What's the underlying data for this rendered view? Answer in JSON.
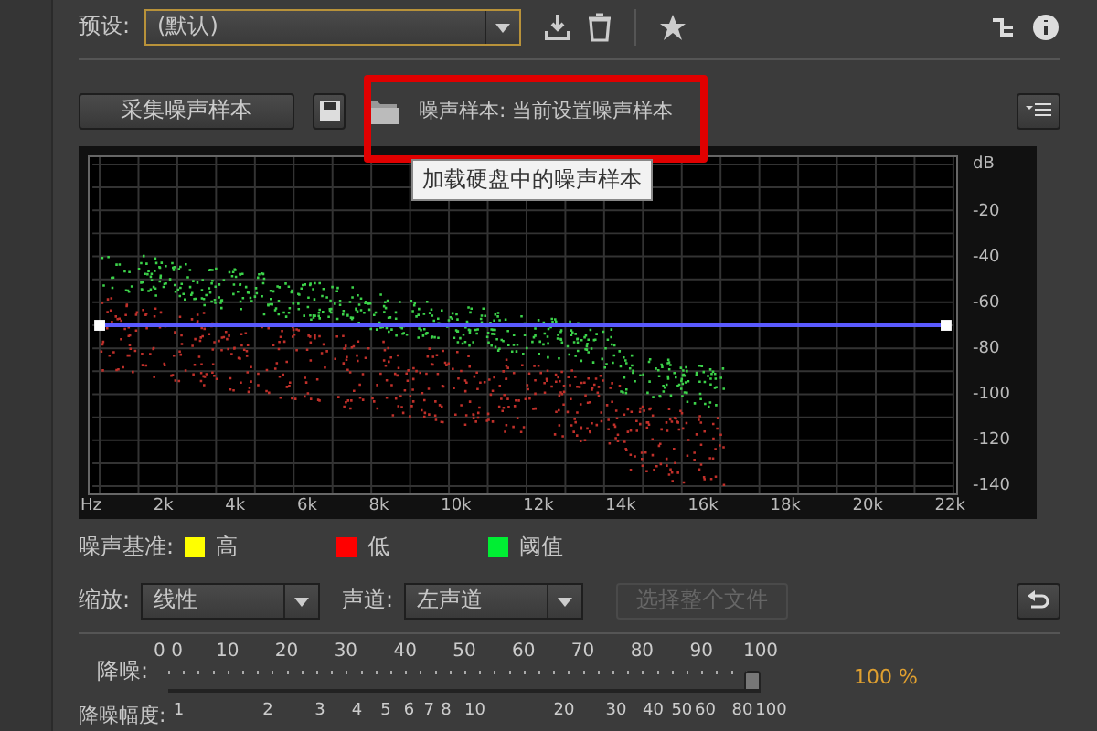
{
  "preset": {
    "label": "预设:",
    "value": "(默认)"
  },
  "noise_sample": {
    "capture_button": "采集噪声样本",
    "label": "噪声样本: 当前设置噪声样本",
    "tooltip": "加载硬盘中的噪声样本"
  },
  "chart": {
    "y_labels": [
      "dB",
      "-20",
      "-40",
      "-60",
      "-80",
      "-100",
      "-120",
      "-140"
    ],
    "x_labels": [
      "Hz",
      "2k",
      "4k",
      "6k",
      "8k",
      "10k",
      "12k",
      "14k",
      "16k",
      "18k",
      "20k",
      "22k"
    ]
  },
  "legend": {
    "label": "噪声基准:",
    "items": [
      {
        "label": "高",
        "color": "#ffff00"
      },
      {
        "label": "低",
        "color": "#ff0000"
      },
      {
        "label": "阈值",
        "color": "#00ee33"
      }
    ]
  },
  "scale": {
    "label": "缩放:",
    "value": "线性"
  },
  "channel": {
    "label": "声道:",
    "value": "左声道"
  },
  "select_file_button": {
    "label": "选择整个文件",
    "disabled": true
  },
  "noise_reduction": {
    "label": "降噪:",
    "ticks": [
      "0 0",
      "10",
      "20",
      "30",
      "40",
      "50",
      "60",
      "70",
      "80",
      "90",
      "100"
    ],
    "level": 1,
    "reading": "100 %"
  },
  "reduction_amount": {
    "label": "降噪幅度:",
    "ticks": [
      "1",
      "2",
      "3",
      "4",
      "5",
      "6",
      "7",
      "8",
      "10",
      "20",
      "30",
      "40",
      "50",
      "60",
      "80",
      "100"
    ]
  }
}
